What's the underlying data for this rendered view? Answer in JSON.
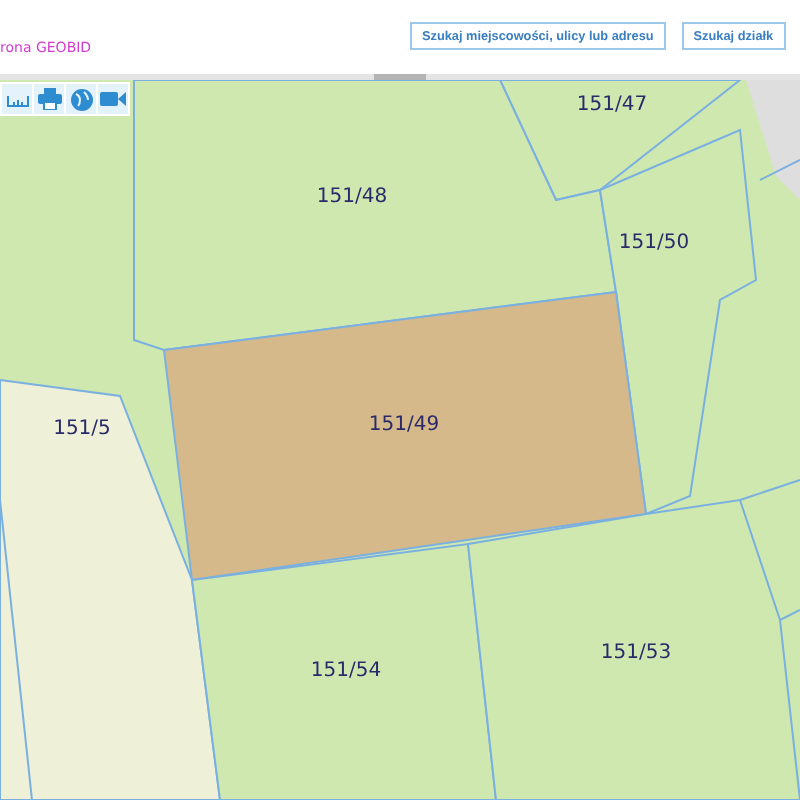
{
  "header": {
    "brand_text": "rona GEOBID",
    "buttons": [
      {
        "label": "Szukaj miejscowości, ulicy lub adresu"
      },
      {
        "label": "Szukaj działk"
      }
    ]
  },
  "map": {
    "parcels": [
      {
        "label": "151/47",
        "selected": false
      },
      {
        "label": "151/48",
        "selected": false
      },
      {
        "label": "151/50",
        "selected": false
      },
      {
        "label": "151/49",
        "selected": true
      },
      {
        "label": "151/5",
        "selected": false
      },
      {
        "label": "151/54",
        "selected": false
      },
      {
        "label": "151/53",
        "selected": false
      }
    ]
  }
}
